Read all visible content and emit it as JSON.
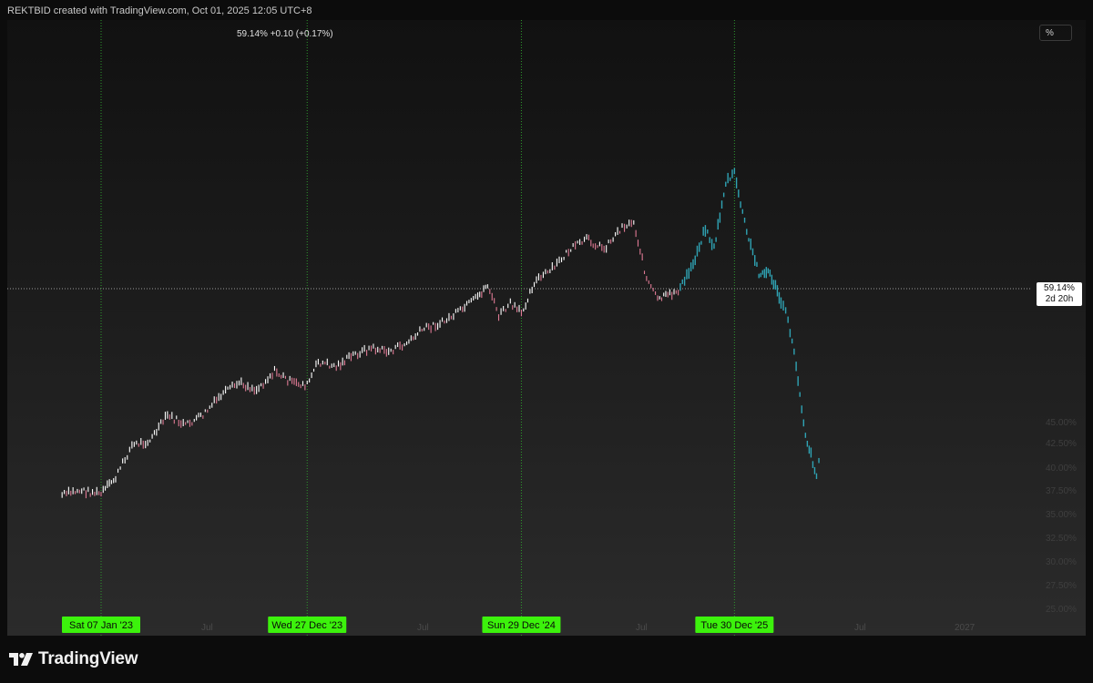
{
  "header": {
    "attribution": "REKTBID created with TradingView.com, Oct 01, 2025 12:05 UTC+8"
  },
  "legend": {
    "value": "59.14%  +0.10 (+0.17%)"
  },
  "scale": {
    "unit": "%"
  },
  "current": {
    "value": "59.14%",
    "countdown": "2d 20h"
  },
  "brand": {
    "name": "TradingView"
  },
  "colors": {
    "history_up": "#ffffff",
    "history_down": "#e07a95",
    "projection": "#2fa3b4",
    "date_tag": "#3cf20c",
    "vline": "#2e9a2e"
  },
  "chart_data": {
    "type": "line",
    "title": "",
    "xlabel": "",
    "ylabel": "",
    "x_ticks": [
      "Jul",
      "Jul",
      "Jul",
      "Jul",
      "2027"
    ],
    "y_ticks": [
      "45.00%",
      "42.50%",
      "40.00%",
      "37.50%",
      "35.00%",
      "32.50%",
      "30.00%",
      "27.50%",
      "25.00%"
    ],
    "cycle_markers": [
      {
        "date": "2023-01-07",
        "label": "Sat 07 Jan '23"
      },
      {
        "date": "2023-12-27",
        "label": "Wed 27 Dec '23"
      },
      {
        "date": "2024-12-29",
        "label": "Sun 29 Dec '24"
      },
      {
        "date": "2025-12-30",
        "label": "Tue 30 Dec '25"
      }
    ],
    "series": [
      {
        "values": [
          [
            "2022-11-01",
            41.3
          ],
          [
            "2022-12-01",
            41.7
          ],
          [
            "2023-01-07",
            41.4
          ],
          [
            "2023-02-01",
            42.8
          ],
          [
            "2023-03-01",
            45.6
          ],
          [
            "2023-04-01",
            46.0
          ],
          [
            "2023-05-01",
            48.2
          ],
          [
            "2023-06-01",
            47.3
          ],
          [
            "2023-07-01",
            48.2
          ],
          [
            "2023-08-01",
            49.9
          ],
          [
            "2023-09-01",
            51.0
          ],
          [
            "2023-10-01",
            50.4
          ],
          [
            "2023-11-01",
            52.0
          ],
          [
            "2023-12-01",
            51.0
          ],
          [
            "2023-12-27",
            50.8
          ],
          [
            "2024-01-15",
            52.8
          ],
          [
            "2024-02-15",
            52.4
          ],
          [
            "2024-03-15",
            53.4
          ],
          [
            "2024-04-15",
            54.0
          ],
          [
            "2024-05-15",
            53.7
          ],
          [
            "2024-06-15",
            54.4
          ],
          [
            "2024-07-15",
            55.7
          ],
          [
            "2024-08-15",
            56.2
          ],
          [
            "2024-09-15",
            57.2
          ],
          [
            "2024-10-15",
            58.4
          ],
          [
            "2024-11-01",
            59.5
          ],
          [
            "2024-11-20",
            56.8
          ],
          [
            "2024-12-10",
            57.8
          ],
          [
            "2024-12-29",
            57.0
          ],
          [
            "2025-01-20",
            59.7
          ],
          [
            "2025-02-20",
            60.8
          ],
          [
            "2025-03-20",
            62.4
          ],
          [
            "2025-04-20",
            63.4
          ],
          [
            "2025-05-20",
            62.6
          ],
          [
            "2025-06-20",
            64.5
          ],
          [
            "2025-07-10",
            64.9
          ],
          [
            "2025-08-01",
            60.0
          ],
          [
            "2025-08-20",
            58.2
          ],
          [
            "2025-09-10",
            58.6
          ],
          [
            "2025-09-28",
            59.14
          ]
        ]
      },
      {
        "values": [
          [
            "2025-09-28",
            59.14
          ],
          [
            "2025-10-20",
            61.3
          ],
          [
            "2025-11-10",
            64.4
          ],
          [
            "2025-11-25",
            62.6
          ],
          [
            "2025-12-15",
            68.3
          ],
          [
            "2025-12-30",
            69.1
          ],
          [
            "2026-01-20",
            64.0
          ],
          [
            "2026-02-10",
            60.5
          ],
          [
            "2026-03-01",
            60.5
          ],
          [
            "2026-03-20",
            58.0
          ],
          [
            "2026-04-01",
            56.5
          ],
          [
            "2026-04-15",
            52.5
          ],
          [
            "2026-05-01",
            46.5
          ],
          [
            "2026-05-20",
            43.0
          ],
          [
            "2026-05-28",
            45.5
          ]
        ]
      }
    ]
  }
}
